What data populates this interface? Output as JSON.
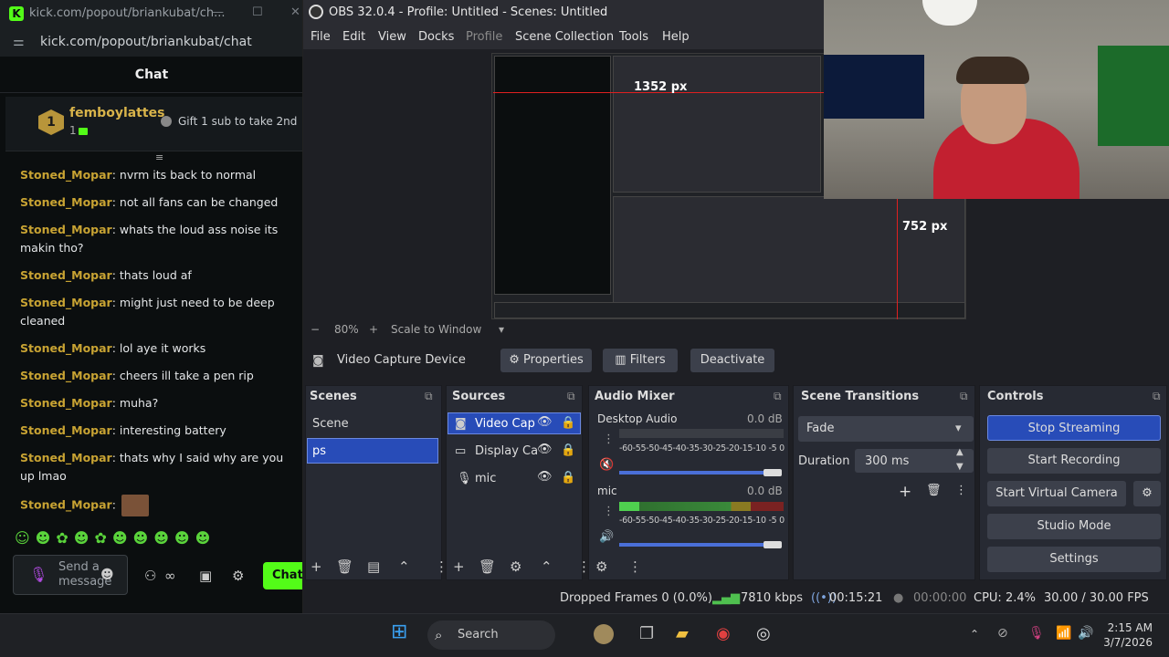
{
  "kick": {
    "window_title": "kick.com/popout/briankubat/ch...",
    "url": "kick.com/popout/briankubat/chat",
    "chat_header": "Chat",
    "pinned": {
      "user": "femboylattes",
      "count": "1",
      "gift_text": "Gift 1 sub to take 2nd"
    },
    "messages": [
      {
        "user": "Stoned_Mopar",
        "text": " nvrm its back to normal"
      },
      {
        "user": "Stoned_Mopar",
        "text": " not all fans can be changed"
      },
      {
        "user": "Stoned_Mopar",
        "text": " whats the loud ass noise its makin tho?"
      },
      {
        "user": "Stoned_Mopar",
        "text": " thats loud af"
      },
      {
        "user": "Stoned_Mopar",
        "text": " might just need to be deep cleaned"
      },
      {
        "user": "Stoned_Mopar",
        "text": " lol aye it works"
      },
      {
        "user": "Stoned_Mopar",
        "text": " cheers ill take a pen rip"
      },
      {
        "user": "Stoned_Mopar",
        "text": " muha?"
      },
      {
        "user": "Stoned_Mopar",
        "text": " interesting battery"
      },
      {
        "user": "Stoned_Mopar",
        "text": " thats why I said why are you up lmao"
      },
      {
        "user": "Stoned_Mopar",
        "text": ""
      }
    ],
    "emotes": "☺☻✿☻✿☻☻☻☻☻",
    "send_placeholder": "Send a message",
    "chat_button": "Chat",
    "colon": ":"
  },
  "obs": {
    "title": "OBS 32.0.4 - Profile: Untitled - Scenes: Untitled",
    "menu": [
      "File",
      "Edit",
      "View",
      "Docks",
      "Profile",
      "Scene Collection",
      "Tools",
      "Help"
    ],
    "preview_px_w": "1352 px",
    "preview_px_h": "752 px",
    "zoom": "80%",
    "zoom_mode": "Scale to Window",
    "selected_source": "Video Capture Device",
    "source_buttons": {
      "properties": "Properties",
      "filters": "Filters",
      "deactivate": "Deactivate"
    },
    "docks": {
      "scenes": {
        "title": "Scenes",
        "items": [
          "Scene",
          "ps"
        ]
      },
      "sources": {
        "title": "Sources",
        "items": [
          "Video Cap",
          "Display Ca",
          "mic"
        ]
      },
      "mixer": {
        "title": "Audio Mixer",
        "channels": [
          {
            "name": "Desktop Audio",
            "db": "0.0 dB",
            "level": 0
          },
          {
            "name": "mic",
            "db": "0.0 dB",
            "level": 0.82
          }
        ],
        "scale": "-60-55-50-45-40-35-30-25-20-15-10 -5  0"
      },
      "transitions": {
        "title": "Scene Transitions",
        "selected": "Fade",
        "duration_label": "Duration",
        "duration": "300 ms"
      },
      "controls": {
        "title": "Controls",
        "buttons": [
          "Stop Streaming",
          "Start Recording",
          "Start Virtual Camera",
          "Studio Mode",
          "Settings"
        ]
      }
    },
    "status": {
      "dropped": "Dropped Frames 0 (0.0%)",
      "bitrate": "7810 kbps",
      "stream_time": "00:15:21",
      "rec_time": "00:00:00",
      "cpu": "CPU: 2.4%",
      "fps": "30.00 / 30.00 FPS"
    }
  },
  "taskbar": {
    "search": "Search",
    "time": "2:15 AM",
    "date": "3/7/2026"
  }
}
